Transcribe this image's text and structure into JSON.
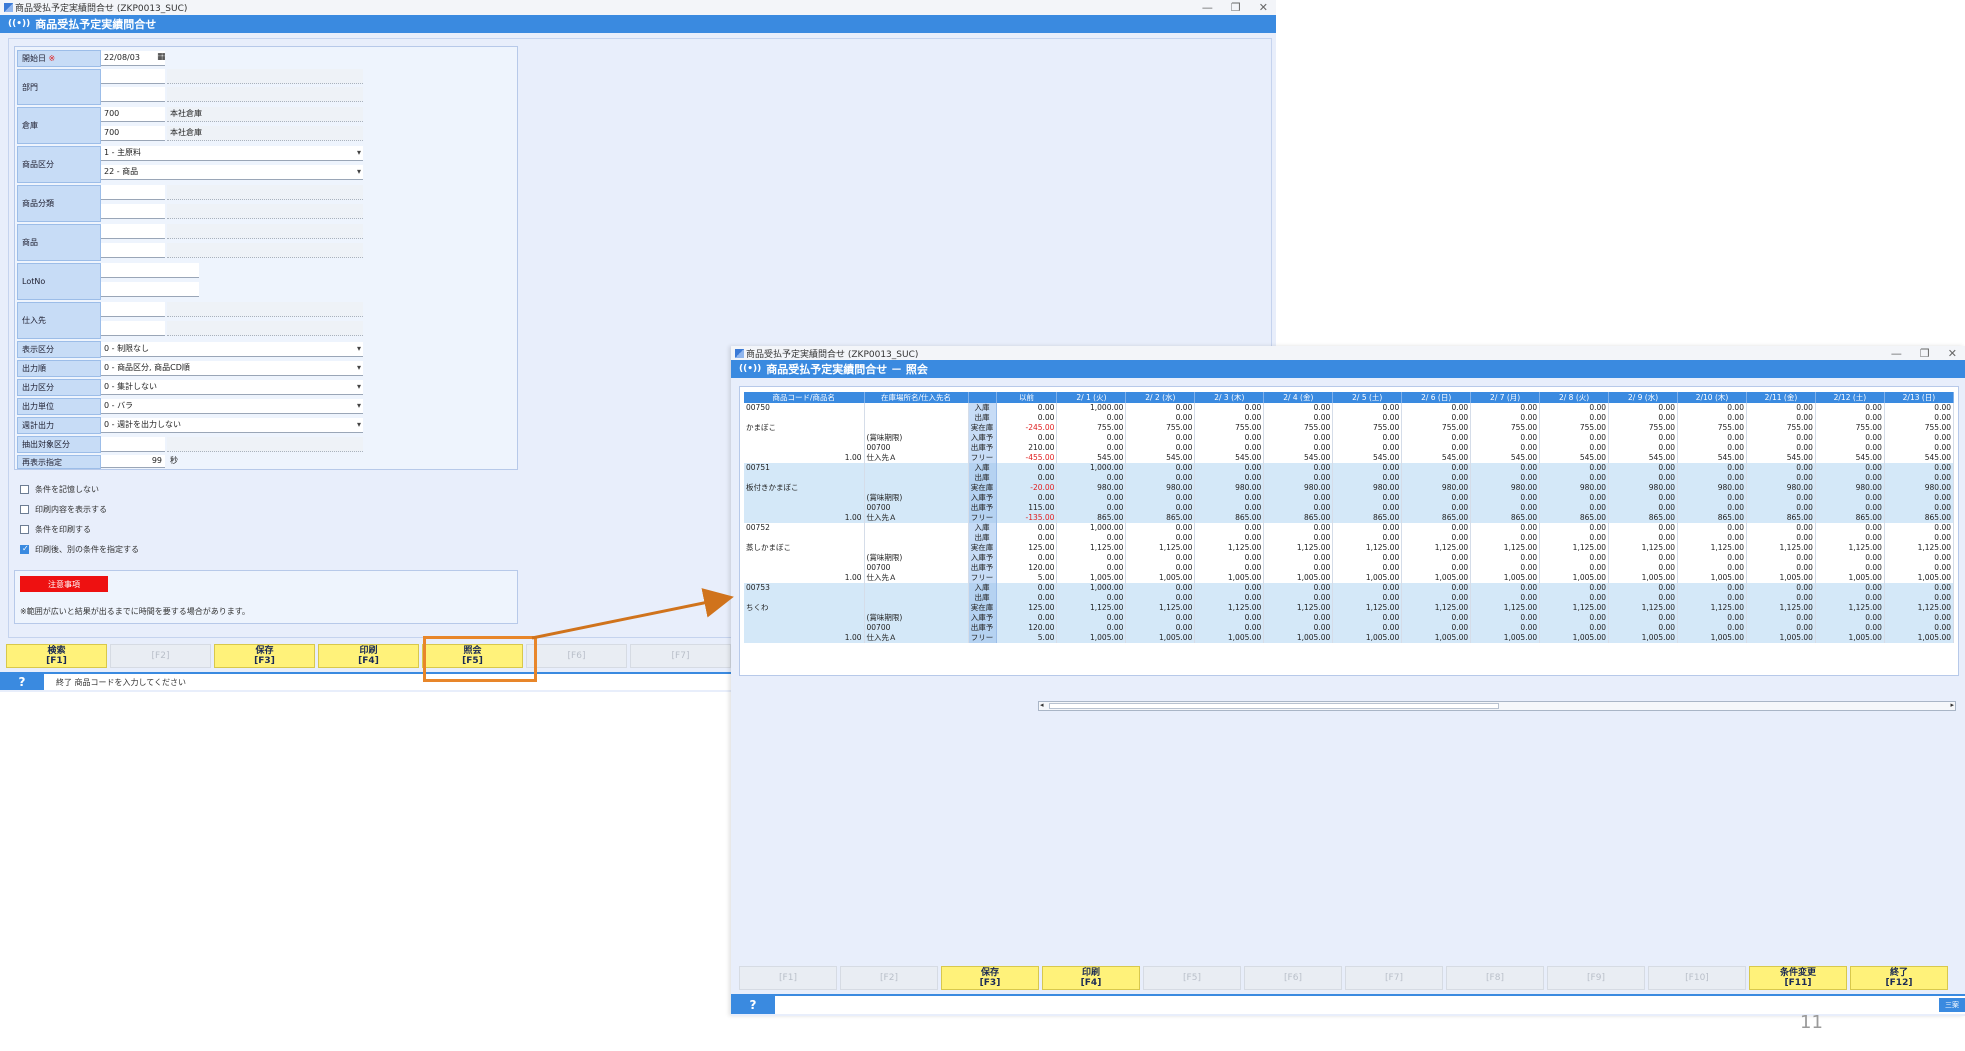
{
  "window1": {
    "title": "商品受払予定実績問合せ (ZKP0013_SUC)",
    "header": "商品受払予定実績問合せ",
    "fields": {
      "start_date_label": "開始日",
      "required_mark": "※",
      "start_date_value": "22/08/03",
      "dept_label": "部門",
      "warehouse_label": "倉庫",
      "warehouse_from_code": "700",
      "warehouse_from_name": "本社倉庫",
      "warehouse_to_code": "700",
      "warehouse_to_name": "本社倉庫",
      "item_category_label": "商品区分",
      "item_category_from": "1 - 主原料",
      "item_category_to": "22 - 商品",
      "item_class_label": "商品分類",
      "item_label": "商品",
      "lot_label": "LotNo",
      "supplier_label": "仕入先",
      "display_label": "表示区分",
      "display_value": "0 - 制限なし",
      "output_order_label": "出力順",
      "output_order_value": "0 - 商品区分, 商品CD順",
      "output_type_label": "出力区分",
      "output_type_value": "0 - 集計しない",
      "output_unit_label": "出力単位",
      "output_unit_value": "0 - バラ",
      "weekly_label": "週計出力",
      "weekly_value": "0 - 週計を出力しない",
      "extract_label": "抽出対象区分",
      "refresh_label": "再表示指定",
      "refresh_value": "99",
      "refresh_unit": "秒"
    },
    "checkboxes": [
      {
        "label": "条件を記憶しない",
        "checked": false
      },
      {
        "label": "印刷内容を表示する",
        "checked": false
      },
      {
        "label": "条件を印刷する",
        "checked": false
      },
      {
        "label": "印刷後、別の条件を指定する",
        "checked": true
      }
    ],
    "notice_button": "注意事項",
    "notice_text": "※範囲が広いと結果が出るまでに時間を要する場合があります。",
    "fkeys": [
      {
        "label": "検索",
        "key": "[F1]",
        "active": true
      },
      {
        "label": "",
        "key": "[F2]",
        "active": false
      },
      {
        "label": "保存",
        "key": "[F3]",
        "active": true
      },
      {
        "label": "印刷",
        "key": "[F4]",
        "active": true
      },
      {
        "label": "照会",
        "key": "[F5]",
        "active": true
      },
      {
        "label": "",
        "key": "[F6]",
        "active": false
      },
      {
        "label": "",
        "key": "[F7]",
        "active": false
      }
    ],
    "status_icon": "?",
    "status_message": "終了 商品コードを入力してください"
  },
  "window2": {
    "title": "商品受払予定実績問合せ (ZKP0013_SUC)",
    "header": "商品受払予定実績問合せ － 照会",
    "columns": [
      "商品コード/商品名",
      "在庫場所名/仕入先名",
      "",
      "以前",
      "2/ 1 (火)",
      "2/ 2 (水)",
      "2/ 3 (木)",
      "2/ 4 (金)",
      "2/ 5 (土)",
      "2/ 6 (日)",
      "2/ 7 (月)",
      "2/ 8 (火)",
      "2/ 9 (水)",
      "2/10 (木)",
      "2/11 (金)",
      "2/12 (土)",
      "2/13 (日)"
    ],
    "kinds": [
      "入庫",
      "出庫",
      "実在庫",
      "入庫予",
      "出庫予",
      "フリー"
    ],
    "items": [
      {
        "code": "00750",
        "name": "かまぼこ",
        "qty": "1.00",
        "wh": [
          "",
          "",
          "",
          "(賞味期限)",
          "00700",
          "仕入先Ａ"
        ],
        "rows": [
          [
            "0.00",
            "1,000.00",
            "0.00",
            "0.00",
            "0.00",
            "0.00",
            "0.00",
            "0.00",
            "0.00",
            "0.00",
            "0.00",
            "0.00",
            "0.00",
            "0.00"
          ],
          [
            "0.00",
            "0.00",
            "0.00",
            "0.00",
            "0.00",
            "0.00",
            "0.00",
            "0.00",
            "0.00",
            "0.00",
            "0.00",
            "0.00",
            "0.00",
            "0.00"
          ],
          [
            "-245.00",
            "755.00",
            "755.00",
            "755.00",
            "755.00",
            "755.00",
            "755.00",
            "755.00",
            "755.00",
            "755.00",
            "755.00",
            "755.00",
            "755.00",
            "755.00"
          ],
          [
            "0.00",
            "0.00",
            "0.00",
            "0.00",
            "0.00",
            "0.00",
            "0.00",
            "0.00",
            "0.00",
            "0.00",
            "0.00",
            "0.00",
            "0.00",
            "0.00"
          ],
          [
            "210.00",
            "0.00",
            "0.00",
            "0.00",
            "0.00",
            "0.00",
            "0.00",
            "0.00",
            "0.00",
            "0.00",
            "0.00",
            "0.00",
            "0.00",
            "0.00"
          ],
          [
            "-455.00",
            "545.00",
            "545.00",
            "545.00",
            "545.00",
            "545.00",
            "545.00",
            "545.00",
            "545.00",
            "545.00",
            "545.00",
            "545.00",
            "545.00",
            "545.00"
          ]
        ]
      },
      {
        "code": "00751",
        "name": "板付きかまぼこ",
        "qty": "1.00",
        "wh": [
          "",
          "",
          "",
          "(賞味期限)",
          "00700",
          "仕入先Ａ"
        ],
        "rows": [
          [
            "0.00",
            "1,000.00",
            "0.00",
            "0.00",
            "0.00",
            "0.00",
            "0.00",
            "0.00",
            "0.00",
            "0.00",
            "0.00",
            "0.00",
            "0.00",
            "0.00"
          ],
          [
            "0.00",
            "0.00",
            "0.00",
            "0.00",
            "0.00",
            "0.00",
            "0.00",
            "0.00",
            "0.00",
            "0.00",
            "0.00",
            "0.00",
            "0.00",
            "0.00"
          ],
          [
            "-20.00",
            "980.00",
            "980.00",
            "980.00",
            "980.00",
            "980.00",
            "980.00",
            "980.00",
            "980.00",
            "980.00",
            "980.00",
            "980.00",
            "980.00",
            "980.00"
          ],
          [
            "0.00",
            "0.00",
            "0.00",
            "0.00",
            "0.00",
            "0.00",
            "0.00",
            "0.00",
            "0.00",
            "0.00",
            "0.00",
            "0.00",
            "0.00",
            "0.00"
          ],
          [
            "115.00",
            "0.00",
            "0.00",
            "0.00",
            "0.00",
            "0.00",
            "0.00",
            "0.00",
            "0.00",
            "0.00",
            "0.00",
            "0.00",
            "0.00",
            "0.00"
          ],
          [
            "-135.00",
            "865.00",
            "865.00",
            "865.00",
            "865.00",
            "865.00",
            "865.00",
            "865.00",
            "865.00",
            "865.00",
            "865.00",
            "865.00",
            "865.00",
            "865.00"
          ]
        ]
      },
      {
        "code": "00752",
        "name": "蒸しかまぼこ",
        "qty": "1.00",
        "wh": [
          "",
          "",
          "",
          "(賞味期限)",
          "00700",
          "仕入先Ａ"
        ],
        "rows": [
          [
            "0.00",
            "1,000.00",
            "0.00",
            "0.00",
            "0.00",
            "0.00",
            "0.00",
            "0.00",
            "0.00",
            "0.00",
            "0.00",
            "0.00",
            "0.00",
            "0.00"
          ],
          [
            "0.00",
            "0.00",
            "0.00",
            "0.00",
            "0.00",
            "0.00",
            "0.00",
            "0.00",
            "0.00",
            "0.00",
            "0.00",
            "0.00",
            "0.00",
            "0.00"
          ],
          [
            "125.00",
            "1,125.00",
            "1,125.00",
            "1,125.00",
            "1,125.00",
            "1,125.00",
            "1,125.00",
            "1,125.00",
            "1,125.00",
            "1,125.00",
            "1,125.00",
            "1,125.00",
            "1,125.00",
            "1,125.00"
          ],
          [
            "0.00",
            "0.00",
            "0.00",
            "0.00",
            "0.00",
            "0.00",
            "0.00",
            "0.00",
            "0.00",
            "0.00",
            "0.00",
            "0.00",
            "0.00",
            "0.00"
          ],
          [
            "120.00",
            "0.00",
            "0.00",
            "0.00",
            "0.00",
            "0.00",
            "0.00",
            "0.00",
            "0.00",
            "0.00",
            "0.00",
            "0.00",
            "0.00",
            "0.00"
          ],
          [
            "5.00",
            "1,005.00",
            "1,005.00",
            "1,005.00",
            "1,005.00",
            "1,005.00",
            "1,005.00",
            "1,005.00",
            "1,005.00",
            "1,005.00",
            "1,005.00",
            "1,005.00",
            "1,005.00",
            "1,005.00"
          ]
        ]
      },
      {
        "code": "00753",
        "name": "ちくわ",
        "qty": "1.00",
        "wh": [
          "",
          "",
          "",
          "(賞味期限)",
          "00700",
          "仕入先Ａ"
        ],
        "rows": [
          [
            "0.00",
            "1,000.00",
            "0.00",
            "0.00",
            "0.00",
            "0.00",
            "0.00",
            "0.00",
            "0.00",
            "0.00",
            "0.00",
            "0.00",
            "0.00",
            "0.00"
          ],
          [
            "0.00",
            "0.00",
            "0.00",
            "0.00",
            "0.00",
            "0.00",
            "0.00",
            "0.00",
            "0.00",
            "0.00",
            "0.00",
            "0.00",
            "0.00",
            "0.00"
          ],
          [
            "125.00",
            "1,125.00",
            "1,125.00",
            "1,125.00",
            "1,125.00",
            "1,125.00",
            "1,125.00",
            "1,125.00",
            "1,125.00",
            "1,125.00",
            "1,125.00",
            "1,125.00",
            "1,125.00",
            "1,125.00"
          ],
          [
            "0.00",
            "0.00",
            "0.00",
            "0.00",
            "0.00",
            "0.00",
            "0.00",
            "0.00",
            "0.00",
            "0.00",
            "0.00",
            "0.00",
            "0.00",
            "0.00"
          ],
          [
            "120.00",
            "0.00",
            "0.00",
            "0.00",
            "0.00",
            "0.00",
            "0.00",
            "0.00",
            "0.00",
            "0.00",
            "0.00",
            "0.00",
            "0.00",
            "0.00"
          ],
          [
            "5.00",
            "1,005.00",
            "1,005.00",
            "1,005.00",
            "1,005.00",
            "1,005.00",
            "1,005.00",
            "1,005.00",
            "1,005.00",
            "1,005.00",
            "1,005.00",
            "1,005.00",
            "1,005.00",
            "1,005.00"
          ]
        ]
      }
    ],
    "fkeys": [
      {
        "label": "",
        "key": "[F1]",
        "active": false
      },
      {
        "label": "",
        "key": "[F2]",
        "active": false
      },
      {
        "label": "保存",
        "key": "[F3]",
        "active": true
      },
      {
        "label": "印刷",
        "key": "[F4]",
        "active": true
      },
      {
        "label": "",
        "key": "[F5]",
        "active": false
      },
      {
        "label": "",
        "key": "[F6]",
        "active": false
      },
      {
        "label": "",
        "key": "[F7]",
        "active": false
      },
      {
        "label": "",
        "key": "[F8]",
        "active": false
      },
      {
        "label": "",
        "key": "[F9]",
        "active": false
      },
      {
        "label": "",
        "key": "[F10]",
        "active": false
      },
      {
        "label": "条件変更",
        "key": "[F11]",
        "active": true
      },
      {
        "label": "終了",
        "key": "[F12]",
        "active": true
      }
    ],
    "status_icon": "?",
    "status_message": "",
    "close_tag": "三案"
  },
  "page_number": "11",
  "colors": {
    "accent": "#3a8ae0",
    "fkey": "#fff27a",
    "highlight": "#e8862a",
    "alert": "#ee1111"
  }
}
